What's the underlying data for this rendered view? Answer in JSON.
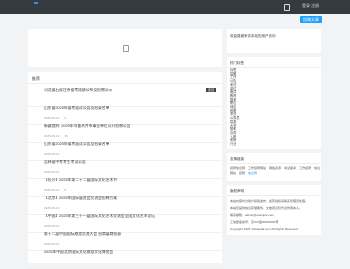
{
  "topbar": {
    "links": [
      "登录",
      "注册"
    ],
    "submit_label": "投稿文章"
  },
  "side_info": {
    "text": "欢迎感谢来访本站的用户访问"
  },
  "list": {
    "header": "推荐",
    "items": [
      {
        "title": "河北省石家庄市省考成绩公布及招聘公示",
        "date": "",
        "views": "",
        "comments": "",
        "badge": "置顶"
      },
      {
        "title": "山东省2025年省考面试公告及招录名单",
        "date": "2025-05-12",
        "views": "9",
        "comments": "",
        "badge": ""
      },
      {
        "title": "新疆首府: 2025年乌鲁木齐市事业单位公开招聘公告",
        "date": "2025-05-12",
        "views": "15",
        "comments": "",
        "badge": ""
      },
      {
        "title": "山东省2025年省考面试公告及招录名单",
        "date": "2025-05-12",
        "views": "",
        "comments": "",
        "badge": ""
      },
      {
        "title": "吉林省中考考生考试公告",
        "date": "2025-05-12",
        "views": "",
        "comments": "",
        "badge": ""
      },
      {
        "title": "【长沙】2025年第二十二届国际文化艺术节",
        "date": "2025-05-12",
        "views": "8",
        "comments": "",
        "badge": ""
      },
      {
        "title": "【北京】2025年国际展览会交流会招聘方案",
        "date": "2025-05-12",
        "views": "",
        "comments": "",
        "badge": ""
      },
      {
        "title": "【中国】2025年第三十一届国际文化艺术交流会全国文化艺术论坛",
        "date": "2025-05-12",
        "views": "",
        "comments": "",
        "badge": ""
      },
      {
        "title": "第十二届中国国际旅游交流大会 招商展商招募",
        "date": "2025-05-12",
        "views": "",
        "comments": "",
        "badge": ""
      },
      {
        "title": "2025年中国北京国际文化旅游文化博览会",
        "date": "",
        "views": "",
        "comments": "",
        "badge": ""
      }
    ]
  },
  "tags": {
    "title": "热门标签",
    "items": [
      "标签",
      "招聘",
      "工作",
      "公告",
      "考试",
      "单位",
      "面试",
      "教育",
      "国考",
      "职位",
      "地区",
      "政策",
      "事业",
      "公务员",
      "招录",
      "大学",
      "报考",
      "合同",
      "入职",
      "考研",
      "行业"
    ]
  },
  "friend_links": {
    "title": "友情链接",
    "rows": [
      [
        "招聘信息网",
        "工作招聘网站",
        "网络资源",
        "考试备考",
        "工作招聘",
        "信息"
      ],
      [
        "网站",
        "招聘",
        "信息网"
      ]
    ]
  },
  "about": {
    "title": "版权声明",
    "lines": [
      "本站内容均为用户投稿发布，如有侵权请联系管理员处理。",
      "本站仅提供信息存储服务，文章观点仅代表作者本人。",
      "联系邮箱：admin@example.com",
      "工信部备案号：京ICP备00000000号",
      "Copyright 2025 Yishaodai.com All Rights Reserved."
    ]
  }
}
